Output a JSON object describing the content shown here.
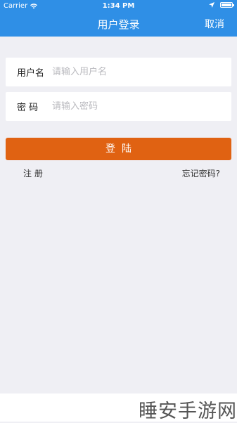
{
  "status_bar": {
    "carrier": "Carrier",
    "time": "1:34 PM",
    "icons": [
      "wifi-icon",
      "location-arrow-icon",
      "battery-icon"
    ]
  },
  "nav": {
    "title": "用户登录",
    "cancel_label": "取消"
  },
  "form": {
    "username_label": "用户名",
    "username_placeholder": "请输入用户名",
    "password_label": "密 码",
    "password_placeholder": "请输入密码"
  },
  "actions": {
    "login_label": "登  陆",
    "register_label": "注 册",
    "forgot_label": "忘记密码?"
  },
  "watermark": "睡安手游网",
  "colors": {
    "nav_blue": "#2f8fe6",
    "login_orange": "#e06212",
    "background": "#efeff4"
  }
}
